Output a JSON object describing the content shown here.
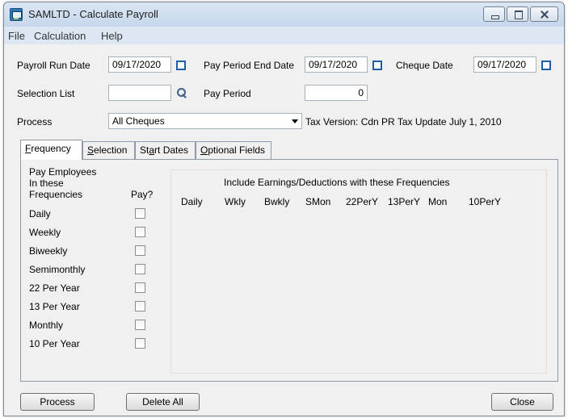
{
  "window": {
    "title": "SAMLTD - Calculate Payroll"
  },
  "menu": [
    "File",
    "Calculation",
    "Help"
  ],
  "form": {
    "payroll_run_date_label": "Payroll Run Date",
    "payroll_run_date": "09/17/2020",
    "pay_period_end_date_label": "Pay Period End Date",
    "pay_period_end_date": "09/17/2020",
    "cheque_date_label": "Cheque Date",
    "cheque_date": "09/17/2020",
    "selection_list_label": "Selection List",
    "selection_list": "",
    "pay_period_label": "Pay Period",
    "pay_period": "0",
    "process_label": "Process",
    "process_value": "All Cheques",
    "tax_version": "Tax Version:  Cdn PR Tax Update July 1, 2010"
  },
  "tabs": [
    {
      "first": "F",
      "rest": "requency"
    },
    {
      "first": "S",
      "rest": "election"
    },
    {
      "pre": "St",
      "mid": "a",
      "rest": "rt Dates"
    },
    {
      "first": "O",
      "rest": "ptional Fields"
    }
  ],
  "frequency": {
    "header_line1": "Pay Employees",
    "header_line2": "In these",
    "header_line3": "Frequencies",
    "pay_header": "Pay?",
    "rows": [
      "Daily",
      "Weekly",
      "Biweekly",
      "Semimonthly",
      "22 Per Year",
      "13 Per Year",
      "Monthly",
      "10 Per Year"
    ],
    "include_title": "Include Earnings/Deductions with these Frequencies",
    "include_columns": [
      "Daily",
      "Wkly",
      "Bwkly",
      "SMon",
      "22PerY",
      "13PerY",
      "Mon",
      "10PerY"
    ]
  },
  "buttons": {
    "process": "Process",
    "delete_all": "Delete All",
    "close": "Close"
  }
}
